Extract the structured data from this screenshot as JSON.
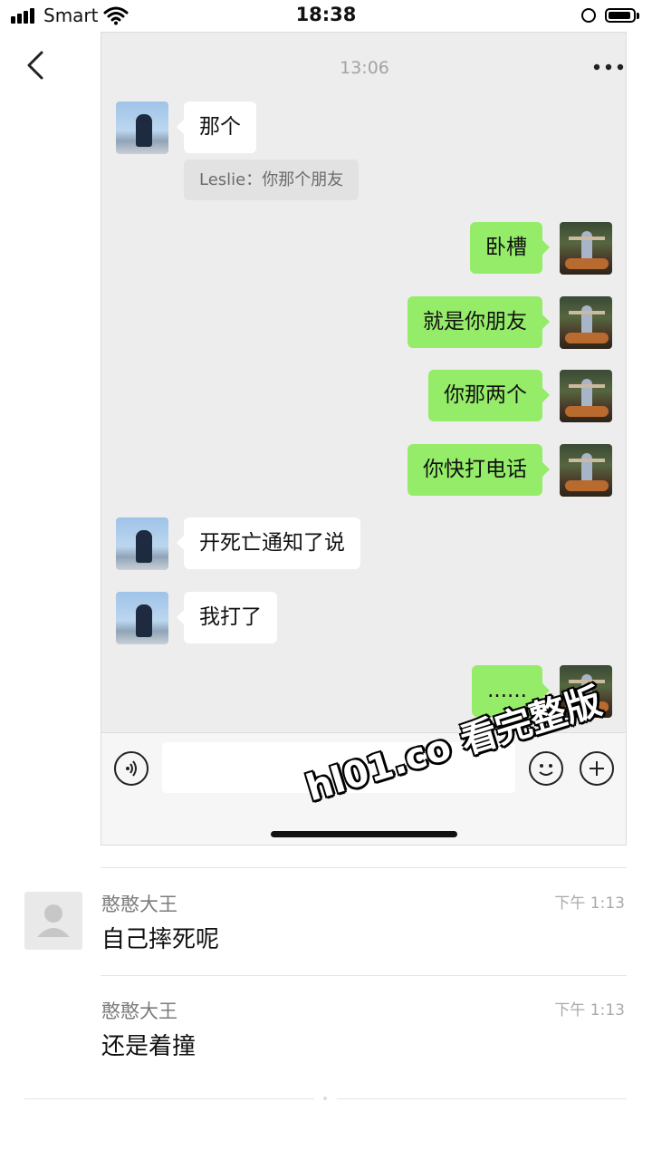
{
  "status_bar": {
    "carrier": "Smart",
    "time": "18:38"
  },
  "chat": {
    "timestamp": "13:06",
    "messages": [
      {
        "side": "left",
        "text": "那个"
      },
      {
        "side": "left",
        "type": "quote",
        "text": "Leslie：你那个朋友"
      },
      {
        "side": "right",
        "text": "卧槽"
      },
      {
        "side": "right",
        "text": "就是你朋友"
      },
      {
        "side": "right",
        "text": "你那两个"
      },
      {
        "side": "right",
        "text": "你快打电话"
      },
      {
        "side": "left",
        "text": "开死亡通知了说"
      },
      {
        "side": "left",
        "text": "我打了"
      },
      {
        "side": "right",
        "text": "......"
      }
    ]
  },
  "watermark": "hl01.co 看完整版",
  "comments": [
    {
      "name": "憨憨大王",
      "time": "下午 1:13",
      "text": "自己摔死呢"
    },
    {
      "name": "憨憨大王",
      "time": "下午 1:13",
      "text": "还是着撞"
    }
  ]
}
